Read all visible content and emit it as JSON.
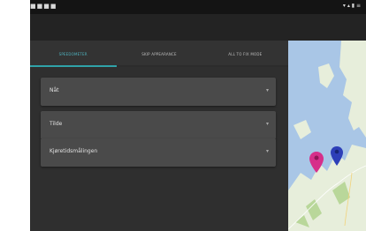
{
  "status_bar": {
    "left_icons": "■■■■",
    "right_icons": "▾ ▴ ▮ ≡"
  },
  "tabs": [
    {
      "label": "SPEEDOMETER"
    },
    {
      "label": "SKIP APPEARANCE"
    },
    {
      "label": "ALL TO FIX MODE"
    }
  ],
  "fields": [
    {
      "label": "Nåt"
    },
    {
      "label": "Tilde"
    },
    {
      "label": "Kjøretidsmålingen"
    }
  ],
  "icons": {
    "dropdown": "chevron-down-icon",
    "map_pin_primary": "location-pin-icon",
    "map_pin_secondary": "location-pin-icon"
  },
  "colors": {
    "accent": "#2fa3a9",
    "pin_primary": "#d62f8a",
    "pin_secondary": "#2d3fb8",
    "water": "#a9c6e6",
    "land": "#e7eedb"
  }
}
